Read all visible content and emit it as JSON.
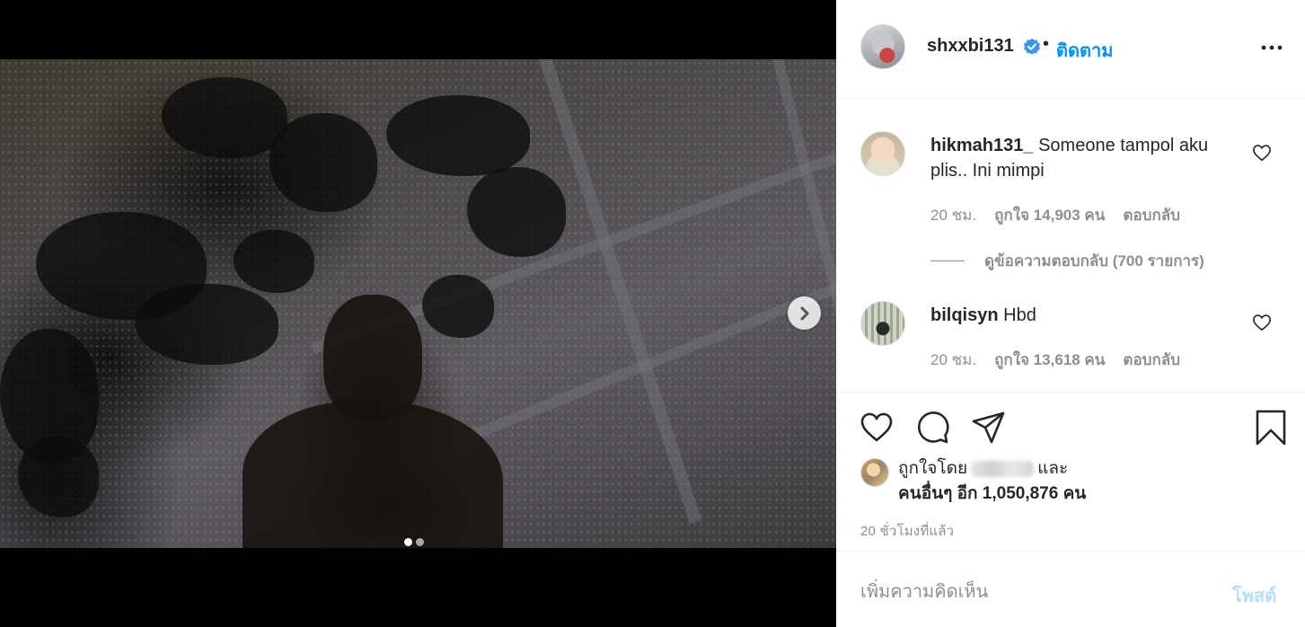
{
  "post": {
    "media": {
      "carousel_total": 2,
      "carousel_active_index": 0,
      "next_icon": "chevron-right-icon"
    },
    "header": {
      "username": "shxxbi131",
      "verified": true,
      "separator": "•",
      "follow_label": "ติดตาม",
      "more_icon": "more-options-icon"
    },
    "comments": [
      {
        "username": "hikmah131_",
        "text": " Someone tampol aku plis.. Ini mimpi",
        "time": "20 ชม.",
        "likes": "ถูกใจ 14,903 คน",
        "reply_label": "ตอบกลับ",
        "view_replies": "ดูข้อความตอบกลับ (700 รายการ)"
      },
      {
        "username": "bilqisyn",
        "text": " Hbd",
        "time": "20 ชม.",
        "likes": "ถูกใจ 13,618 คน",
        "reply_label": "ตอบกลับ"
      }
    ],
    "actions": {
      "like_icon": "heart-icon",
      "comment_icon": "comment-icon",
      "share_icon": "send-icon",
      "save_icon": "bookmark-icon"
    },
    "likes_summary": {
      "prefix": "ถูกใจโดย",
      "suffix": "และ",
      "others": "คนอื่นๆ อีก 1,050,876 คน"
    },
    "time_ago": "20 ชั่วโมงที่แล้ว",
    "add_comment": {
      "placeholder": "เพิ่มความคิดเห็น",
      "post_label": "โพสต์"
    },
    "colors": {
      "accent": "#0095f6",
      "post_disabled": "#b2dffc",
      "muted": "#8e8e8e",
      "text": "#262626"
    }
  }
}
